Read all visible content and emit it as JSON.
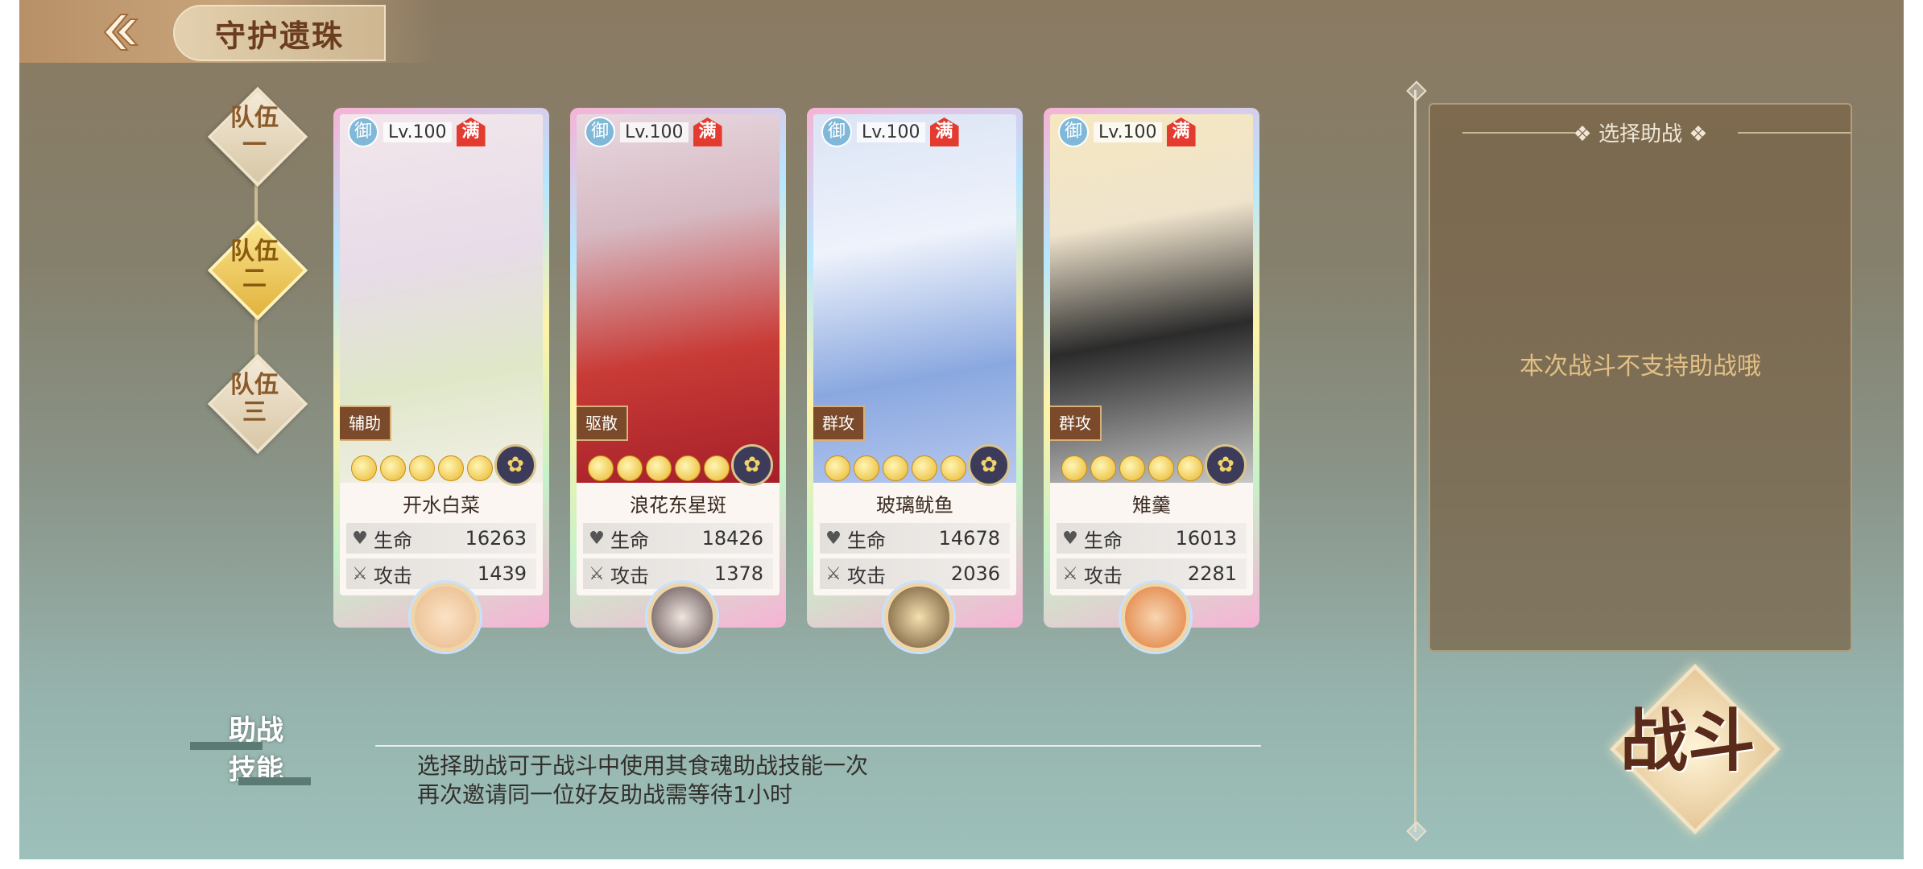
{
  "header": {
    "title": "守护遗珠",
    "back_icon": "back-arrow-icon"
  },
  "teams": [
    {
      "label_top": "队伍",
      "label_bottom": "一",
      "active": false
    },
    {
      "label_top": "队伍",
      "label_bottom": "二",
      "active": true
    },
    {
      "label_top": "队伍",
      "label_bottom": "三",
      "active": false
    }
  ],
  "cards": [
    {
      "name": "开水白菜",
      "level": "Lv.100",
      "badge": "御",
      "max": "满",
      "role": "辅助",
      "hp_label": "生命",
      "hp": "16263",
      "atk_label": "攻击",
      "atk": "1439",
      "stars": 6,
      "portrait_colors": [
        "#f3e7ec",
        "#dfe7c8"
      ]
    },
    {
      "name": "浪花东星斑",
      "level": "Lv.100",
      "badge": "御",
      "max": "满",
      "role": "驱散",
      "hp_label": "生命",
      "hp": "18426",
      "atk_label": "攻击",
      "atk": "1378",
      "stars": 6,
      "portrait_colors": [
        "#e8d8e0",
        "#c83b36"
      ]
    },
    {
      "name": "玻璃鱿鱼",
      "level": "Lv.100",
      "badge": "御",
      "max": "满",
      "role": "群攻",
      "hp_label": "生命",
      "hp": "14678",
      "atk_label": "攻击",
      "atk": "2036",
      "stars": 6,
      "portrait_colors": [
        "#dbe4f5",
        "#8aa8e0"
      ]
    },
    {
      "name": "雉羹",
      "level": "Lv.100",
      "badge": "御",
      "max": "满",
      "role": "群攻",
      "hp_label": "生命",
      "hp": "16013",
      "atk_label": "攻击",
      "atk": "2281",
      "stars": 6,
      "portrait_colors": [
        "#f5e8c0",
        "#2b2b2b"
      ]
    }
  ],
  "assist_panel": {
    "title": "选择助战",
    "message": "本次战斗不支持助战哦"
  },
  "fight_button": {
    "label": "战斗"
  },
  "assist_skill": {
    "title_line1": "助战",
    "title_line2": "技能",
    "desc_line1": "选择助战可于战斗中使用其食魂助战技能一次",
    "desc_line2": "再次邀请同一位好友助战需等待1小时"
  }
}
